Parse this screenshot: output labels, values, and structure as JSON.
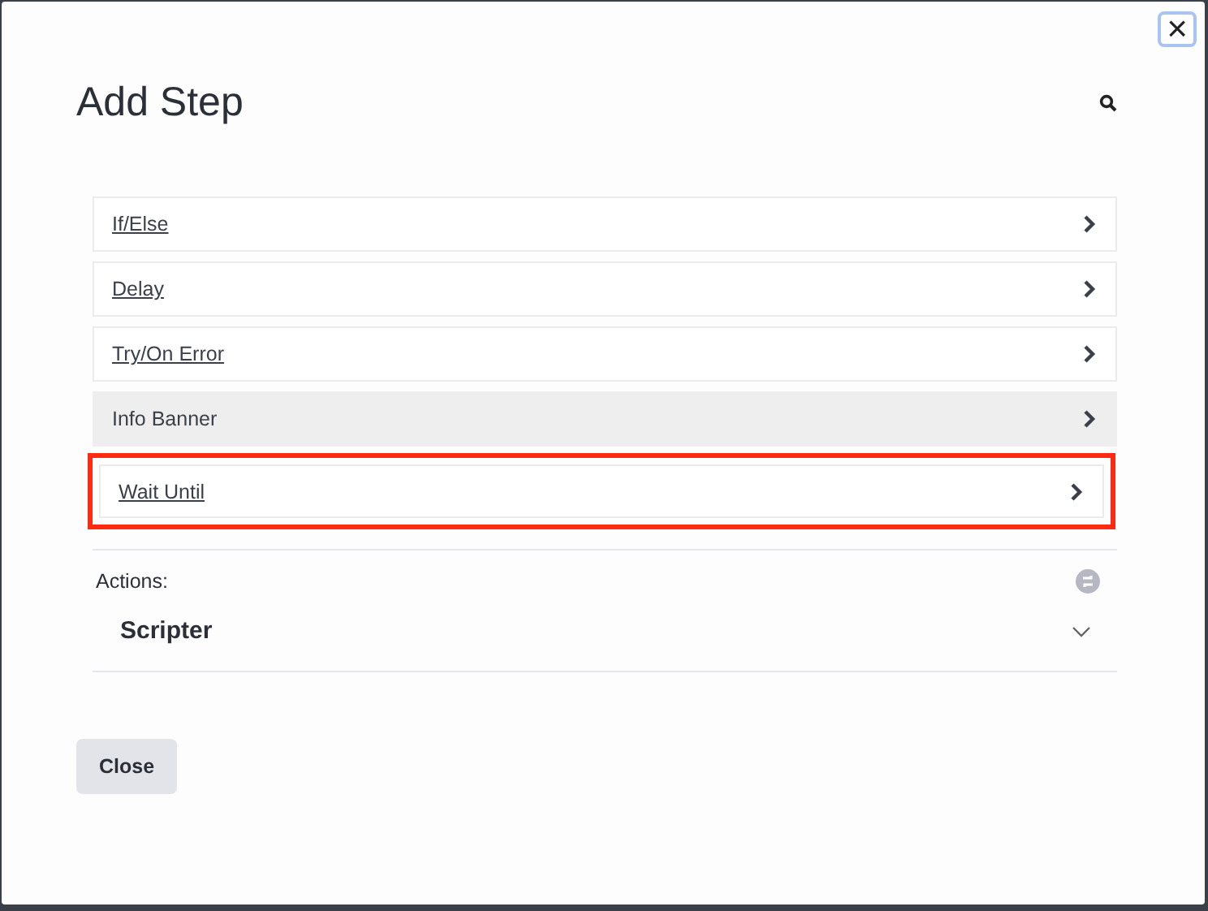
{
  "dialog": {
    "title": "Add Step",
    "close_button": "×"
  },
  "steps": [
    {
      "label": "If/Else",
      "kind": "link",
      "hovered": false,
      "highlighted": false
    },
    {
      "label": "Delay",
      "kind": "link",
      "hovered": false,
      "highlighted": false
    },
    {
      "label": "Try/On Error",
      "kind": "link",
      "hovered": false,
      "highlighted": false
    },
    {
      "label": "Info Banner",
      "kind": "text",
      "hovered": true,
      "highlighted": false
    },
    {
      "label": "Wait Until",
      "kind": "link",
      "hovered": false,
      "highlighted": true
    }
  ],
  "actions": {
    "label": "Actions:",
    "group": {
      "title": "Scripter",
      "expanded": false
    }
  },
  "buttons": [
    "Close"
  ]
}
